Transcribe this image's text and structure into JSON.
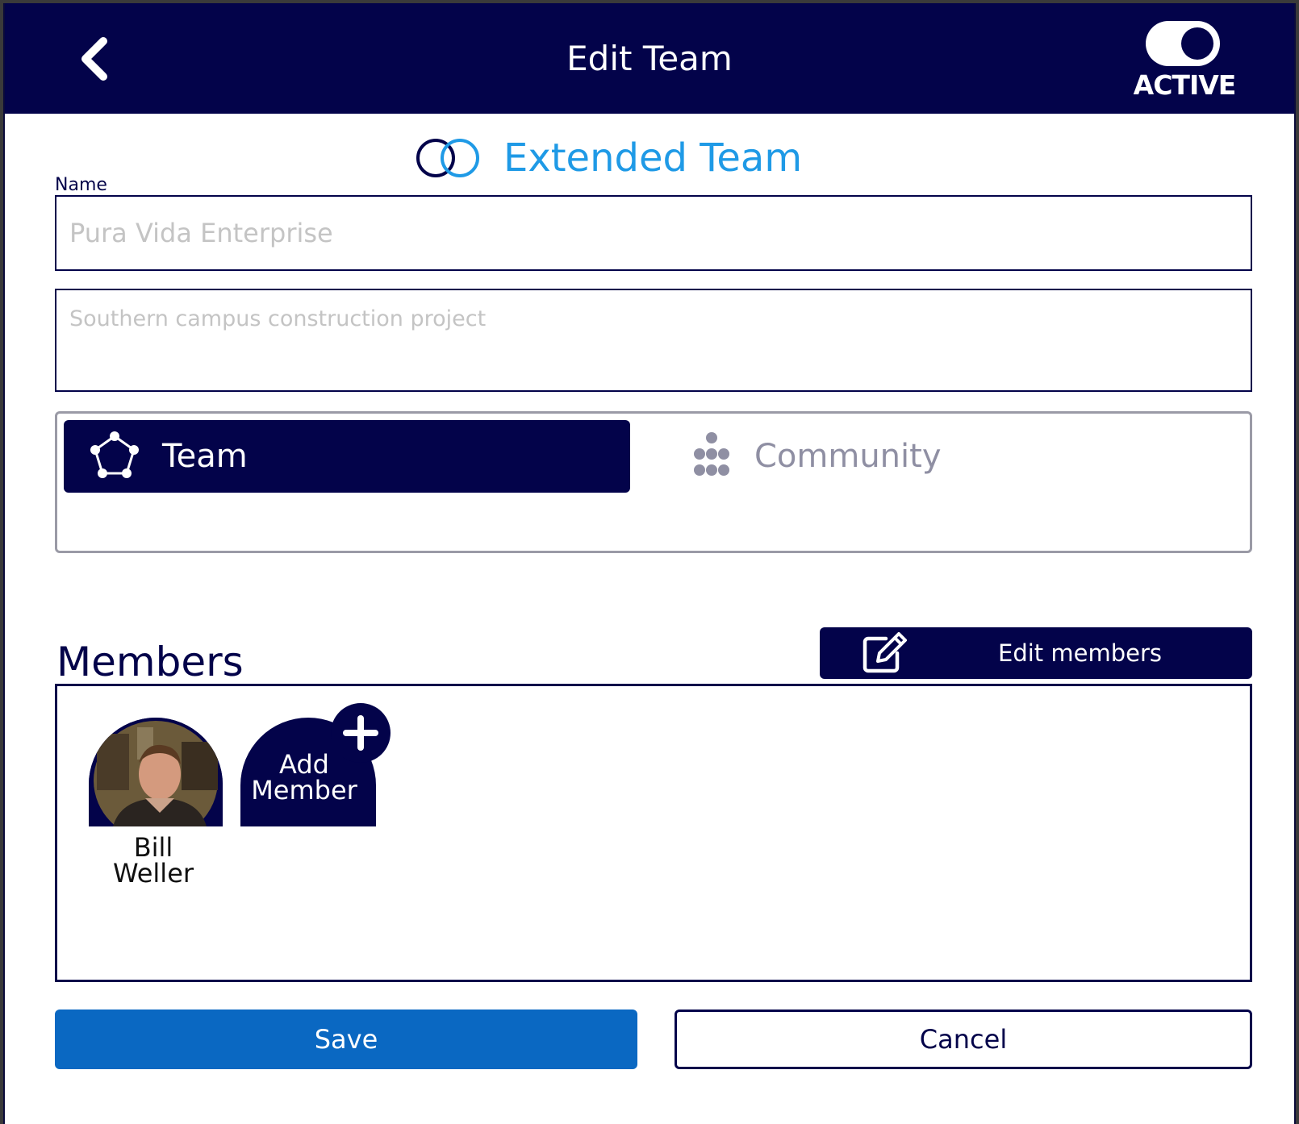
{
  "header": {
    "title": "Edit Team",
    "toggle_label": "ACTIVE",
    "toggle_on": true
  },
  "team_type_label": "Extended Team",
  "form": {
    "name_label": "Name",
    "name_placeholder": "Pura Vida Enterprise",
    "description_placeholder": "Southern campus construction project"
  },
  "type_selector": {
    "selected": "Team",
    "options": [
      {
        "label": "Team",
        "icon": "pentagon-nodes-icon",
        "selected": true
      },
      {
        "label": "Community",
        "icon": "dots-cluster-icon",
        "selected": false
      }
    ]
  },
  "members": {
    "heading": "Members",
    "edit_button_label": "Edit members",
    "list": [
      {
        "name_first": "Bill",
        "name_last": "Weller"
      }
    ],
    "add_label_line1": "Add",
    "add_label_line2": "Member"
  },
  "actions": {
    "save_label": "Save",
    "cancel_label": "Cancel"
  },
  "colors": {
    "navy": "#03034a",
    "accent_blue": "#1f9ae6",
    "save_blue": "#0a68c2",
    "muted": "#8f8fa3"
  }
}
